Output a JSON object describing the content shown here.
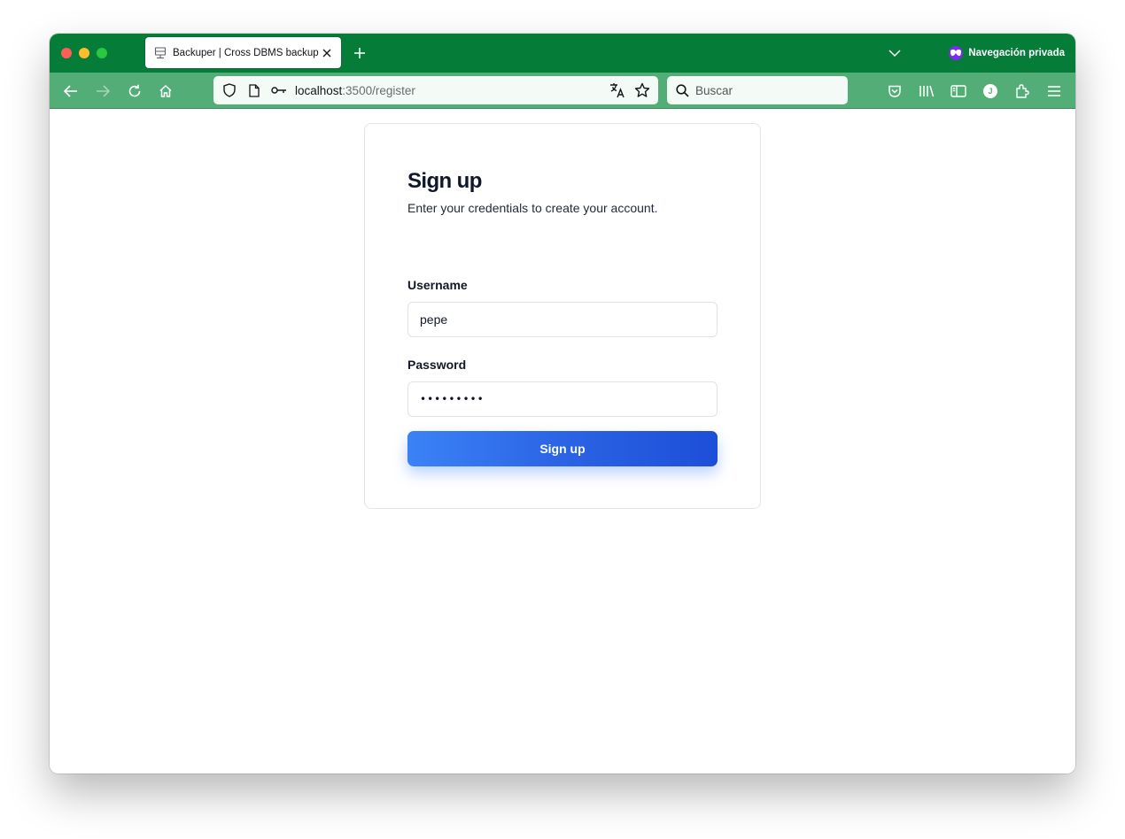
{
  "browser": {
    "tab": {
      "title": "Backuper | Cross DBMS backup"
    },
    "private_label": "Navegación privada",
    "avatar_initial": "J",
    "url": {
      "host": "localhost",
      "rest": ":3500/register"
    },
    "search": {
      "placeholder": "Buscar"
    },
    "colors": {
      "tabbar": "#067c39",
      "navbar": "#52ae76",
      "private_icon": "#7b2cf0"
    }
  },
  "page": {
    "title": "Sign up",
    "subtitle": "Enter your credentials to create your account.",
    "username": {
      "label": "Username",
      "value": "pepe"
    },
    "password": {
      "label": "Password",
      "value": "123456789"
    },
    "submit_label": "Sign up",
    "colors": {
      "button_start": "#3b82f6",
      "button_end": "#1d4ed8"
    }
  }
}
